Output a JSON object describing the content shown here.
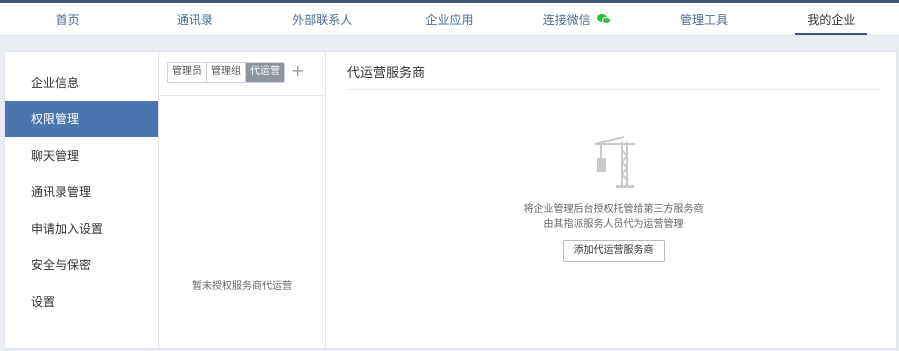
{
  "topnav": {
    "items": [
      {
        "label": "首页"
      },
      {
        "label": "通讯录"
      },
      {
        "label": "外部联系人"
      },
      {
        "label": "企业应用"
      },
      {
        "label": "连接微信",
        "icon": "wechat-icon"
      },
      {
        "label": "管理工具"
      },
      {
        "label": "我的企业",
        "active": true
      }
    ]
  },
  "sidebar": {
    "items": [
      {
        "label": "企业信息"
      },
      {
        "label": "权限管理",
        "active": true
      },
      {
        "label": "聊天管理"
      },
      {
        "label": "通讯录管理"
      },
      {
        "label": "申请加入设置"
      },
      {
        "label": "安全与保密"
      },
      {
        "label": "设置"
      }
    ]
  },
  "middle": {
    "tabs": [
      {
        "label": "管理员"
      },
      {
        "label": "管理组"
      },
      {
        "label": "代运营",
        "active": true
      }
    ],
    "add_icon": "plus-icon",
    "plus_label": "+",
    "empty_text": "暂未授权服务商代运营"
  },
  "content": {
    "title": "代运营服务商",
    "illustration_icon": "crane-icon",
    "desc_line1": "将企业管理后台授权托管给第三方服务商",
    "desc_line2": "由其指派服务人员代为运营管理",
    "add_button": "添加代运营服务商"
  },
  "colors": {
    "nav_accent": "#3f5577",
    "sidebar_active": "#4a75ad",
    "wechat_green": "#2dbe3c",
    "tab_active": "#8e959e"
  }
}
